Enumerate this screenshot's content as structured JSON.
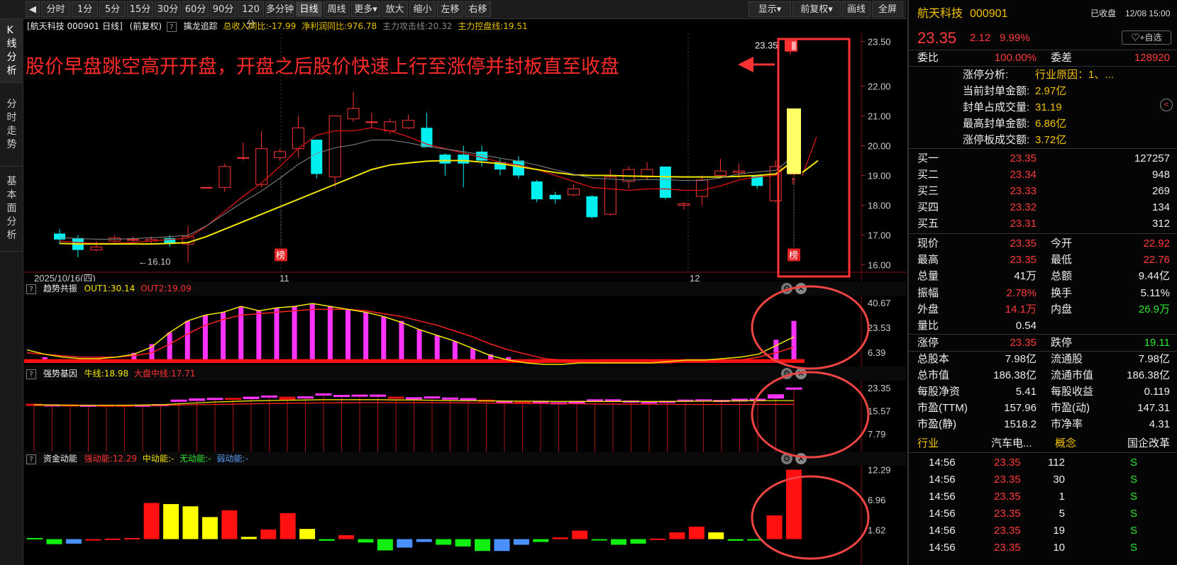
{
  "toolbar": {
    "buttons": [
      "分时",
      "1分",
      "5分",
      "15分",
      "30分",
      "60分",
      "90分",
      "120分",
      "多分钟",
      "日线",
      "周线",
      "更多▾",
      "放大",
      "缩小",
      "左移",
      "右移"
    ],
    "right_buttons": [
      "显示▾",
      "前复权▾",
      "画线",
      "全屏"
    ],
    "active": "日线"
  },
  "left_tabs": [
    "K线分析",
    "分时走势",
    "基本面分析"
  ],
  "chart_header": {
    "title": "[航天科技 000901 日线]",
    "adj": "(前复权)",
    "indicator_name": "擒龙追踪",
    "rev": "总收入同比:-17.99",
    "profit": "净利润同比:976.78",
    "attack": "主力攻击线:20.32",
    "control": "主力控盘线:19.51"
  },
  "annotation": "股价早盘跳空高开开盘，开盘之后股价快速上行至涨停并封板直至收盘",
  "chart_data": [
    {
      "type": "candlestick",
      "title": "航天科技 000901 日线",
      "ylim": [
        15.8,
        23.7
      ],
      "y_ticks": [
        "23.50",
        "22.00",
        "21.00",
        "20.00",
        "19.00",
        "18.00",
        "17.00",
        "16.00"
      ],
      "x_labels": [
        "2025/10/16(四)",
        "11",
        "12"
      ],
      "last_price_label": "23.35",
      "low_label": "16.10",
      "badge": "榜",
      "candles": [
        [
          17.05,
          16.85,
          17.2,
          16.7
        ],
        [
          16.9,
          16.5,
          17.0,
          16.25
        ],
        [
          16.5,
          16.6,
          16.8,
          16.45
        ],
        [
          16.8,
          16.9,
          17.0,
          16.7
        ],
        [
          16.85,
          16.85,
          16.95,
          16.75
        ],
        [
          16.8,
          16.85,
          16.95,
          16.7
        ],
        [
          16.9,
          16.7,
          17.0,
          16.6
        ],
        [
          16.7,
          16.95,
          17.3,
          16.1
        ],
        [
          18.6,
          18.6,
          18.6,
          18.6
        ],
        [
          18.6,
          19.3,
          19.4,
          18.45
        ],
        [
          19.6,
          19.6,
          20.1,
          19.5
        ],
        [
          18.7,
          19.9,
          20.5,
          18.6
        ],
        [
          19.6,
          19.8,
          19.9,
          19.5
        ],
        [
          19.9,
          20.6,
          21.0,
          19.6
        ],
        [
          20.2,
          19.05,
          20.2,
          18.9
        ],
        [
          18.95,
          21.0,
          21.0,
          18.6
        ],
        [
          20.9,
          21.25,
          21.8,
          20.8
        ],
        [
          20.8,
          20.8,
          21.1,
          20.6
        ],
        [
          20.5,
          20.8,
          20.9,
          20.4
        ],
        [
          20.6,
          20.85,
          21.05,
          20.55
        ],
        [
          20.6,
          19.95,
          21.1,
          19.95
        ],
        [
          19.7,
          19.4,
          19.75,
          19.0
        ],
        [
          19.7,
          19.4,
          20.0,
          18.6
        ],
        [
          19.8,
          19.5,
          20.0,
          19.3
        ],
        [
          19.45,
          19.2,
          19.55,
          19.0
        ],
        [
          19.5,
          19.0,
          19.65,
          18.9
        ],
        [
          18.8,
          18.2,
          18.85,
          18.1
        ],
        [
          18.35,
          18.2,
          18.45,
          18.05
        ],
        [
          18.35,
          18.55,
          18.7,
          18.3
        ],
        [
          18.3,
          17.6,
          18.35,
          17.55
        ],
        [
          17.7,
          18.95,
          19.2,
          17.65
        ],
        [
          18.8,
          19.2,
          19.3,
          18.55
        ],
        [
          18.95,
          19.2,
          19.45,
          18.85
        ],
        [
          19.3,
          18.25,
          19.3,
          18.2
        ],
        [
          18.0,
          18.05,
          18.1,
          17.85
        ],
        [
          18.3,
          18.85,
          19.0,
          18.0
        ],
        [
          19.0,
          19.15,
          19.55,
          18.9
        ],
        [
          19.1,
          19.15,
          19.4,
          18.9
        ],
        [
          19.0,
          18.65,
          19.0,
          18.55
        ],
        [
          18.15,
          19.3,
          19.5,
          18.1
        ],
        [
          19.05,
          19.1,
          19.2,
          19.0
        ]
      ],
      "ma_short": [
        16.8,
        16.75,
        16.72,
        16.72,
        16.75,
        16.8,
        16.85,
        16.9,
        17.3,
        17.8,
        18.3,
        18.75,
        19.3,
        19.9,
        20.35,
        20.5,
        20.5,
        20.6,
        20.5,
        20.3,
        20.05,
        19.9,
        19.75,
        19.6,
        19.45,
        19.35,
        19.2,
        19.0,
        18.8,
        18.6,
        18.55,
        18.5,
        18.55,
        18.55,
        18.5,
        18.5,
        18.65,
        18.85,
        18.95,
        19.0,
        19.5
      ],
      "ma_long": [
        16.72,
        16.7,
        16.7,
        16.7,
        16.7,
        16.7,
        16.72,
        16.75,
        16.95,
        17.2,
        17.45,
        17.7,
        17.95,
        18.2,
        18.45,
        18.7,
        18.95,
        19.2,
        19.35,
        19.42,
        19.48,
        19.5,
        19.5,
        19.45,
        19.4,
        19.3,
        19.2,
        19.1,
        19.02,
        19.0,
        19.0,
        18.98,
        18.97,
        18.96,
        18.95,
        18.95,
        18.95,
        18.97,
        19.0,
        19.05,
        19.5
      ]
    },
    {
      "type": "bar+line",
      "title": "趋势共振",
      "series": [
        {
          "name": "OUT1",
          "latest": "30.14"
        },
        {
          "name": "OUT2",
          "latest": "19.09"
        }
      ],
      "y_ticks": [
        "40.67",
        "23.53",
        "6.39"
      ],
      "ylim": [
        -2,
        44
      ],
      "bars": [
        0,
        3,
        0,
        0,
        2,
        1,
        6,
        12,
        20,
        28,
        32,
        34,
        38,
        35,
        37,
        38,
        40,
        38,
        36,
        34,
        31,
        28,
        22,
        18,
        14,
        9,
        5,
        3,
        0,
        0,
        0,
        0,
        0,
        0,
        0,
        0,
        0,
        0,
        0,
        0,
        0,
        0,
        15,
        28
      ],
      "out1": [
        8,
        5,
        3,
        2,
        2,
        3,
        5,
        10,
        20,
        28,
        32,
        34,
        38,
        35,
        37,
        38,
        40,
        38,
        36,
        34,
        31,
        27,
        22,
        18,
        14,
        9,
        4,
        1,
        -1,
        -2,
        -2,
        -1,
        -1,
        -1,
        -1,
        -1,
        0,
        1,
        1,
        2,
        3,
        5,
        11,
        17
      ],
      "out2": [
        6,
        5,
        4,
        3,
        3,
        3,
        4,
        6,
        12,
        19,
        25,
        29,
        32,
        33,
        34,
        35,
        36,
        36,
        36,
        35,
        33,
        31,
        28,
        25,
        21,
        17,
        12,
        8,
        5,
        2,
        1,
        0,
        -1,
        -1,
        -1,
        -1,
        -1,
        0,
        0,
        1,
        1,
        3,
        6,
        10
      ]
    },
    {
      "type": "candle+line",
      "title": "强势基因",
      "series": [
        {
          "name": "牛线",
          "latest": "18.98"
        },
        {
          "name": "大盘中线",
          "latest": "17.71"
        }
      ],
      "y_ticks": [
        "23.35",
        "15.57",
        "7.79"
      ],
      "ylim": [
        2,
        25
      ],
      "candles": [
        [
          17.8,
          17.4
        ],
        [
          17.2,
          17.6
        ],
        [
          17.6,
          17.2
        ],
        [
          17.2,
          17.5
        ],
        [
          17.5,
          17.2
        ],
        [
          17.5,
          17.1
        ],
        [
          17.2,
          17.5
        ],
        [
          17.3,
          17.7
        ],
        [
          18.7,
          19.2
        ],
        [
          19.0,
          19.6
        ],
        [
          19.6,
          19.8
        ],
        [
          19.8,
          19.4
        ],
        [
          19.6,
          20.2
        ],
        [
          20.3,
          20.6
        ],
        [
          20.2,
          19.2
        ],
        [
          20.1,
          20.3
        ],
        [
          20.9,
          21.3
        ],
        [
          20.6,
          20.8
        ],
        [
          20.5,
          20.9
        ],
        [
          20.4,
          20.9
        ],
        [
          20.2,
          19.9
        ],
        [
          19.6,
          20.0
        ],
        [
          19.9,
          20.3
        ],
        [
          19.5,
          19.9
        ],
        [
          19.4,
          19.7
        ],
        [
          19.2,
          18.8
        ],
        [
          18.6,
          18.8
        ],
        [
          18.5,
          18.3
        ],
        [
          18.6,
          18.8
        ],
        [
          18.0,
          18.3
        ],
        [
          18.1,
          18.8
        ],
        [
          18.9,
          19.3
        ],
        [
          18.9,
          19.3
        ],
        [
          18.6,
          18.9
        ],
        [
          18.2,
          18.6
        ],
        [
          18.4,
          18.8
        ],
        [
          18.9,
          19.2
        ],
        [
          18.9,
          19.3
        ],
        [
          18.7,
          19.1
        ],
        [
          18.8,
          19.5
        ],
        [
          18.9,
          19.5
        ],
        [
          19.8,
          21.0
        ],
        [
          22.8,
          23.3
        ]
      ],
      "bull": [
        17.6,
        17.5,
        17.4,
        17.4,
        17.4,
        17.4,
        17.5,
        17.6,
        17.9,
        18.2,
        18.5,
        18.7,
        18.9,
        19.0,
        19.1,
        19.2,
        19.3,
        19.3,
        19.3,
        19.3,
        19.2,
        19.2,
        19.1,
        19.0,
        18.95,
        18.9,
        18.85,
        18.8,
        18.75,
        18.7,
        18.7,
        18.7,
        18.7,
        18.7,
        18.7,
        18.7,
        18.75,
        18.8,
        18.85,
        18.9,
        18.95,
        18.98,
        18.98
      ],
      "mid": [
        17.4,
        17.35,
        17.3,
        17.3,
        17.3,
        17.3,
        17.35,
        17.4,
        17.5,
        17.6,
        17.7,
        17.8,
        17.9,
        18.0,
        18.1,
        18.15,
        18.2,
        18.25,
        18.3,
        18.3,
        18.3,
        18.3,
        18.3,
        18.25,
        18.2,
        18.15,
        18.1,
        18.05,
        18.0,
        17.95,
        17.9,
        17.85,
        17.8,
        17.8,
        17.75,
        17.75,
        17.7,
        17.7,
        17.7,
        17.7,
        17.71,
        17.71,
        17.71
      ]
    },
    {
      "type": "bar",
      "title": "资金动能",
      "series": [
        {
          "name": "强动能",
          "latest": "12.29"
        },
        {
          "name": "中动能",
          "latest": "-"
        },
        {
          "name": "无动能",
          "latest": "-"
        },
        {
          "name": "弱动能",
          "latest": "-"
        }
      ],
      "y_ticks": [
        "12.29",
        "6.96",
        "1.62"
      ],
      "ylim": [
        -4.2,
        12.6
      ],
      "bars": [
        [
          0.2,
          "g"
        ],
        [
          -0.9,
          "g"
        ],
        [
          -0.8,
          "b"
        ],
        [
          -0.1,
          "r"
        ],
        [
          0.1,
          "r"
        ],
        [
          0.2,
          "r"
        ],
        [
          6.4,
          "r"
        ],
        [
          6.2,
          "y"
        ],
        [
          5.8,
          "y"
        ],
        [
          3.9,
          "y"
        ],
        [
          5.1,
          "r"
        ],
        [
          0.4,
          "y"
        ],
        [
          1.7,
          "r"
        ],
        [
          4.6,
          "r"
        ],
        [
          1.8,
          "y"
        ],
        [
          -0.3,
          "g"
        ],
        [
          0.7,
          "r"
        ],
        [
          -0.6,
          "g"
        ],
        [
          -2.0,
          "g"
        ],
        [
          -1.5,
          "b"
        ],
        [
          -0.5,
          "b"
        ],
        [
          -1.0,
          "g"
        ],
        [
          -1.3,
          "g"
        ],
        [
          -2.1,
          "g"
        ],
        [
          -2.1,
          "b"
        ],
        [
          -1.0,
          "b"
        ],
        [
          -0.5,
          "g"
        ],
        [
          0.3,
          "r"
        ],
        [
          1.5,
          "r"
        ],
        [
          -0.2,
          "g"
        ],
        [
          -1.0,
          "g"
        ],
        [
          -0.8,
          "g"
        ],
        [
          0.1,
          "r"
        ],
        [
          1.2,
          "r"
        ],
        [
          2.2,
          "r"
        ],
        [
          1.2,
          "y"
        ],
        [
          -0.3,
          "g"
        ],
        [
          -0.2,
          "g"
        ],
        [
          4.2,
          "r"
        ],
        [
          12.29,
          "r"
        ]
      ]
    }
  ],
  "right_panel": {
    "stock_name": "航天科技",
    "stock_code": "000901",
    "status": "已收盘",
    "date_time": "12/08 15:00",
    "price": "23.35",
    "change": "2.12",
    "change_pct": "9.99%",
    "watch_label": "+自选",
    "weibi_label": "委比",
    "weibi_value": "100.00%",
    "weicha_label": "委差",
    "weicha_value": "128920",
    "limit_info": [
      {
        "label": "涨停分析:",
        "value": "行业原因：1、..."
      },
      {
        "label": "当前封单金额:",
        "value": "2.97亿"
      },
      {
        "label": "封单占成交量:",
        "value": "31.19"
      },
      {
        "label": "最高封单金额:",
        "value": "6.86亿"
      },
      {
        "label": "涨停板成交额:",
        "value": "3.72亿"
      }
    ],
    "bids": [
      {
        "label": "买一",
        "price": "23.35",
        "vol": "127257"
      },
      {
        "label": "买二",
        "price": "23.34",
        "vol": "948"
      },
      {
        "label": "买三",
        "price": "23.33",
        "vol": "269"
      },
      {
        "label": "买四",
        "price": "23.32",
        "vol": "134"
      },
      {
        "label": "买五",
        "price": "23.31",
        "vol": "312"
      }
    ],
    "stats": [
      [
        {
          "l": "现价",
          "v": "23.35",
          "c": "red"
        },
        {
          "l": "今开",
          "v": "22.92",
          "c": "red"
        }
      ],
      [
        {
          "l": "最高",
          "v": "23.35",
          "c": "red"
        },
        {
          "l": "最低",
          "v": "22.76",
          "c": "red"
        }
      ],
      [
        {
          "l": "总量",
          "v": "41万",
          "c": "white"
        },
        {
          "l": "总额",
          "v": "9.44亿",
          "c": "white"
        }
      ],
      [
        {
          "l": "振幅",
          "v": "2.78%",
          "c": "red"
        },
        {
          "l": "换手",
          "v": "5.11%",
          "c": "white"
        }
      ],
      [
        {
          "l": "外盘",
          "v": "14.1万",
          "c": "red"
        },
        {
          "l": "内盘",
          "v": "26.9万",
          "c": "green"
        }
      ],
      [
        {
          "l": "量比",
          "v": "0.54",
          "c": "white"
        },
        {
          "l": "",
          "v": "",
          "c": "white"
        }
      ],
      [
        {
          "l": "涨停",
          "v": "23.35",
          "c": "red"
        },
        {
          "l": "跌停",
          "v": "19.11",
          "c": "green"
        }
      ],
      [
        {
          "l": "总股本",
          "v": "7.98亿",
          "c": "white"
        },
        {
          "l": "流通股",
          "v": "7.98亿",
          "c": "white"
        }
      ],
      [
        {
          "l": "总市值",
          "v": "186.38亿",
          "c": "white"
        },
        {
          "l": "流通市值",
          "v": "186.38亿",
          "c": "white"
        }
      ],
      [
        {
          "l": "每股净资",
          "v": "5.41",
          "c": "white"
        },
        {
          "l": "每股收益",
          "v": "0.119",
          "c": "white"
        }
      ],
      [
        {
          "l": "市盈(TTM)",
          "v": "157.96",
          "c": "white"
        },
        {
          "l": "市盈(动)",
          "v": "147.31",
          "c": "white"
        }
      ],
      [
        {
          "l": "市盈(静)",
          "v": "1518.2",
          "c": "white"
        },
        {
          "l": "市净率",
          "v": "4.31",
          "c": "white"
        }
      ]
    ],
    "industry": {
      "l1": "行业",
      "v1": "汽车电...",
      "l2": "概念",
      "v2": "国企改革"
    },
    "ticks": [
      {
        "time": "14:56",
        "price": "23.35",
        "vol": "112",
        "dir": "S"
      },
      {
        "time": "14:56",
        "price": "23.35",
        "vol": "30",
        "dir": "S"
      },
      {
        "time": "14:56",
        "price": "23.35",
        "vol": "1",
        "dir": "S"
      },
      {
        "time": "14:56",
        "price": "23.35",
        "vol": "5",
        "dir": "S"
      },
      {
        "time": "14:56",
        "price": "23.35",
        "vol": "19",
        "dir": "S"
      },
      {
        "time": "14:56",
        "price": "23.35",
        "vol": "10",
        "dir": "S"
      }
    ]
  }
}
